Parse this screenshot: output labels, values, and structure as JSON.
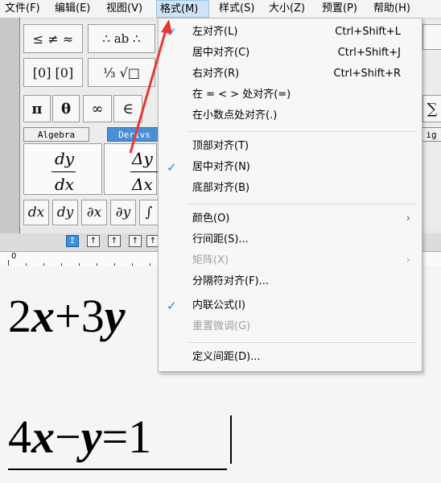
{
  "menubar": {
    "items": [
      {
        "label": "文件(F)"
      },
      {
        "label": "编辑(E)"
      },
      {
        "label": "视图(V)"
      },
      {
        "label": "格式(M)"
      },
      {
        "label": "样式(S)"
      },
      {
        "label": "大小(Z)"
      },
      {
        "label": "预置(P)"
      },
      {
        "label": "帮助(H)"
      }
    ]
  },
  "palette": {
    "row1": [
      "≤ ≠ ≈",
      "∴ ab ∴",
      "[0] [0]",
      "⅓ √□",
      "π",
      "θ",
      "∞",
      "∈"
    ],
    "tabs": [
      "Algebra",
      "Derivs"
    ],
    "tab_right": "ig",
    "big1_num": "dy",
    "big1_den": "dx",
    "big2_num": "Δy",
    "big2_den": "Δx",
    "row4": [
      "dx",
      "dy",
      "∂x",
      "∂y",
      "∫"
    ],
    "sum_symbol": "∑"
  },
  "ruler": {
    "zero": "0"
  },
  "editor": {
    "eq1": {
      "a": "2",
      "b": "x",
      "c": "+3",
      "d": "y"
    },
    "eq2": {
      "a": "4",
      "b": "x",
      "c": "−",
      "d": "y",
      "e": "=1"
    }
  },
  "format_menu": {
    "items": [
      {
        "label": "左对齐(L)",
        "shortcut": "Ctrl+Shift+L",
        "checked": true
      },
      {
        "label": "居中对齐(C)",
        "shortcut": "Ctrl+Shift+J"
      },
      {
        "label": "右对齐(R)",
        "shortcut": "Ctrl+Shift+R"
      },
      {
        "label": "在 = < > 处对齐(=)"
      },
      {
        "label": "在小数点处对齐(.)"
      },
      {
        "label": "顶部对齐(T)"
      },
      {
        "label": "居中对齐(N)",
        "checked": true
      },
      {
        "label": "底部对齐(B)"
      },
      {
        "label": "颜色(O)",
        "submenu": true
      },
      {
        "label": "行间距(S)..."
      },
      {
        "label": "矩阵(X)",
        "submenu": true,
        "disabled": true
      },
      {
        "label": "分隔符对齐(F)..."
      },
      {
        "label": "内联公式(I)",
        "checked": true
      },
      {
        "label": "重置微调(G)",
        "disabled": true
      },
      {
        "label": "定义间距(D)..."
      }
    ],
    "check_glyph": "✓",
    "submenu_glyph": "›"
  },
  "colors": {
    "accent": "#1e88e5",
    "arrow": "#e53935",
    "tab_selected": "#4a8ed6"
  }
}
